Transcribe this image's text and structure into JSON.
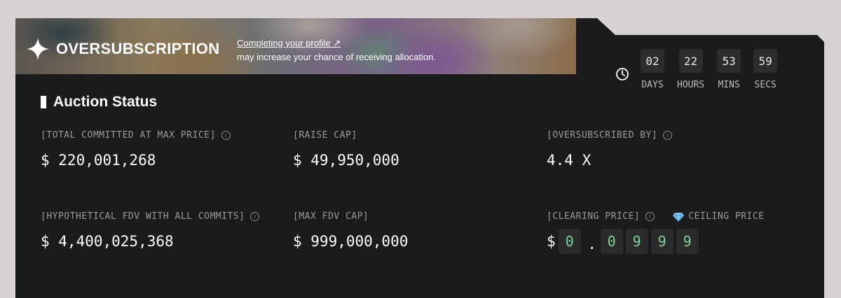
{
  "banner": {
    "title": "OVERSUBSCRIPTION",
    "profile_link": "Completing your profile ↗",
    "subtext": "may increase your chance of receiving allocation."
  },
  "timer": {
    "units": [
      {
        "value": "02",
        "label": "DAYS"
      },
      {
        "value": "22",
        "label": "HOURS"
      },
      {
        "value": "53",
        "label": "MINS"
      },
      {
        "value": "59",
        "label": "SECS"
      }
    ]
  },
  "section": {
    "title": "Auction Status"
  },
  "metrics": {
    "total_committed": {
      "label": "[TOTAL COMMITTED AT MAX PRICE]",
      "value": "$ 220,001,268"
    },
    "raise_cap": {
      "label": "[RAISE CAP]",
      "value": "$ 49,950,000"
    },
    "oversubscribed": {
      "label": "[OVERSUBSCRIBED BY]",
      "value": "4.4 X"
    },
    "hypothetical_fdv": {
      "label": "[HYPOTHETICAL FDV WITH ALL COMMITS]",
      "value": "$ 4,400,025,368"
    },
    "max_fdv": {
      "label": "[MAX FDV CAP]",
      "value": "$ 999,000,000"
    },
    "clearing": {
      "label": "[CLEARING PRICE]",
      "ceiling_label": "CEILING PRICE",
      "currency": "$",
      "digits": [
        "0",
        ".",
        "0",
        "9",
        "9",
        "9"
      ]
    }
  },
  "colors": {
    "card_bg": "#1b1b1b",
    "digit_green": "#7ed39a",
    "page_bg": "#d9d2d2"
  },
  "icons": [
    "sparkle-icon",
    "clock-icon",
    "info-icon",
    "gem-icon"
  ]
}
